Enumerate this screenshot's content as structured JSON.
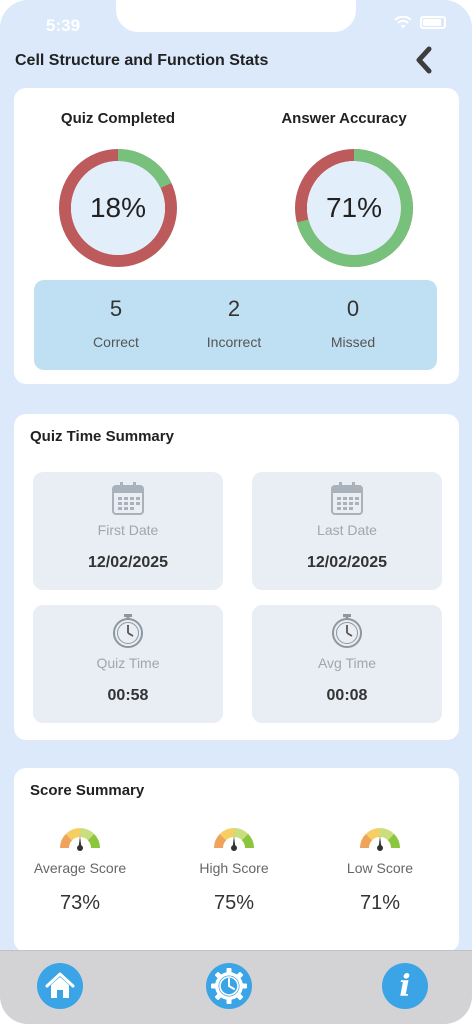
{
  "status_bar": {
    "time": "5:39"
  },
  "header": {
    "title": "Cell Structure and Function Stats",
    "back_icon": "chevron-left-icon"
  },
  "stats": {
    "quiz_completed": {
      "title": "Quiz Completed",
      "percent": 18,
      "label": "18%",
      "fill_color": "#77c17d",
      "rest_color": "#bd5b5c"
    },
    "answer_accuracy": {
      "title": "Answer Accuracy",
      "percent": 71,
      "label": "71%",
      "fill_color": "#77c17d",
      "rest_color": "#bd5b5c"
    },
    "counts": [
      {
        "value": "5",
        "label": "Correct"
      },
      {
        "value": "2",
        "label": "Incorrect"
      },
      {
        "value": "0",
        "label": "Missed"
      }
    ]
  },
  "time_summary": {
    "title": "Quiz Time Summary",
    "tiles": [
      {
        "icon": "calendar-icon",
        "label": "First Date",
        "value": "12/02/2025"
      },
      {
        "icon": "calendar-icon",
        "label": "Last Date",
        "value": "12/02/2025"
      },
      {
        "icon": "stopwatch-icon",
        "label": "Quiz Time",
        "value": "00:58"
      },
      {
        "icon": "stopwatch-icon",
        "label": "Avg Time",
        "value": "00:08"
      }
    ]
  },
  "score_summary": {
    "title": "Score Summary",
    "items": [
      {
        "icon": "gauge-icon",
        "label": "Average Score",
        "value": "73%"
      },
      {
        "icon": "gauge-icon",
        "label": "High Score",
        "value": "75%"
      },
      {
        "icon": "gauge-icon",
        "label": "Low Score",
        "value": "71%"
      }
    ]
  },
  "tabbar": {
    "items": [
      {
        "icon": "home-icon"
      },
      {
        "icon": "settings-icon"
      },
      {
        "icon": "info-icon"
      }
    ],
    "accent": "#3aa4e6"
  }
}
